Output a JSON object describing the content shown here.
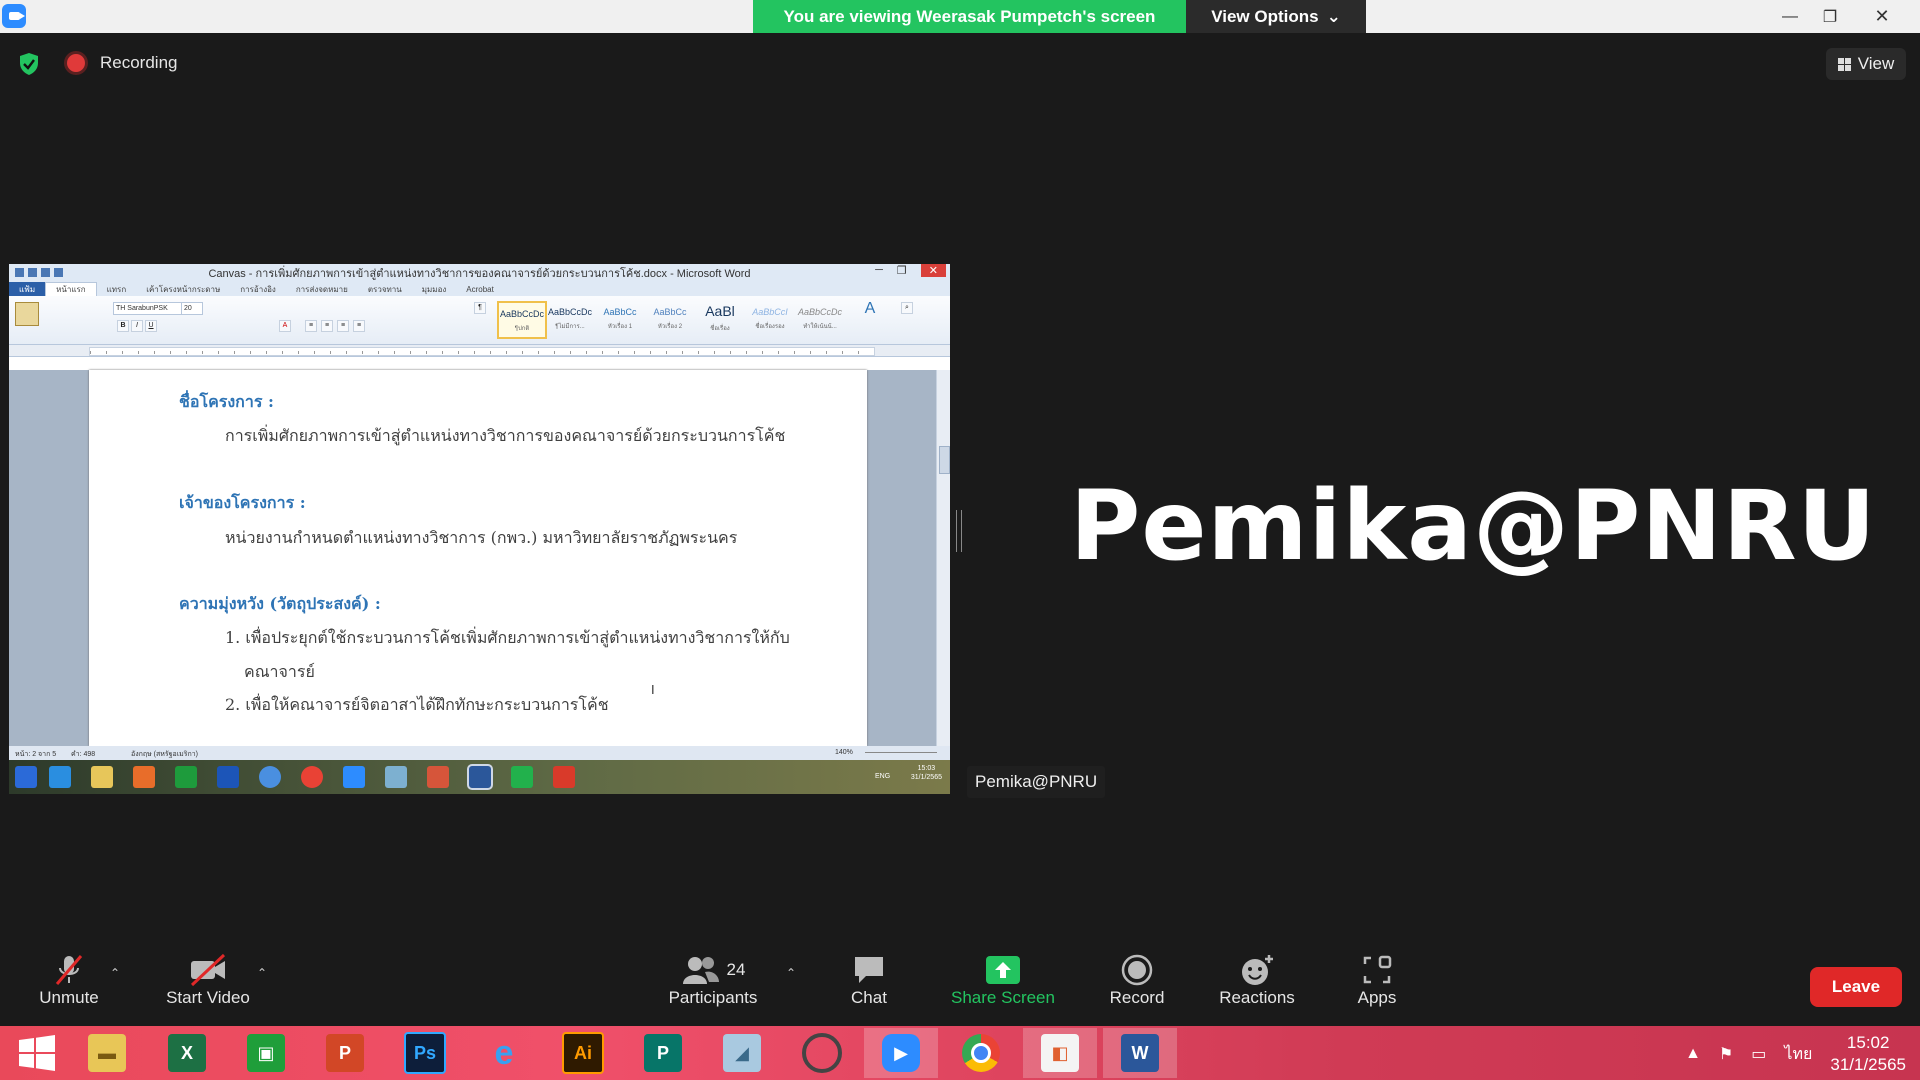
{
  "top_bar": {
    "viewing_banner": "You are viewing Weerasak Pumpetch's screen",
    "view_options_label": "View Options"
  },
  "status": {
    "recording_label": "Recording",
    "view_label": "View"
  },
  "shared_screen": {
    "word_title": "Canvas - การเพิ่มศักยภาพการเข้าสู่ตำแหน่งทางวิชาการของคณาจารย์ด้วยกระบวนการโค้ช.docx - Microsoft Word",
    "ribbon_tabs": [
      "แฟ้ม",
      "หน้าแรก",
      "แทรก",
      "เค้าโครงหน้ากระดาษ",
      "การอ้างอิง",
      "การส่งจดหมาย",
      "ตรวจทาน",
      "มุมมอง",
      "Acrobat"
    ],
    "active_tab_index": 1,
    "font_name": "TH SarabunPSK",
    "font_size": "20",
    "styles": [
      {
        "sample": "AaBbCcDc",
        "name": "¶ปกติ"
      },
      {
        "sample": "AaBbCcDc",
        "name": "¶ไม่มีการ..."
      },
      {
        "sample": "AaBbCc",
        "name": "หัวเรื่อง 1"
      },
      {
        "sample": "AaBbCc",
        "name": "หัวเรื่อง 2"
      },
      {
        "sample": "AaBl",
        "name": "ชื่อเรื่อง"
      },
      {
        "sample": "AaBbCcI",
        "name": "ชื่อเรื่องรอง"
      },
      {
        "sample": "AaBbCcDc",
        "name": "ทำให้เน้นน้..."
      }
    ],
    "document": {
      "heading_project_name": "ชื่อโครงการ :",
      "project_name": "การเพิ่มศักยภาพการเข้าสู่ตำแหน่งทางวิชาการของคณาจารย์ด้วยกระบวนการโค้ช",
      "heading_owner": "เจ้าของโครงการ :",
      "owner": "หน่วยงานกำหนดตำแหน่งทางวิชาการ (กพว.) มหาวิทยาลัยราชภัฏพระนคร",
      "heading_objectives": "ความมุ่งหวัง (วัตถุประสงค์) :",
      "objective_1_line1": "1. เพื่อประยุกต์ใช้กระบวนการโค้ชเพิ่มศักยภาพการเข้าสู่ตำแหน่งทางวิชาการให้กับ",
      "objective_1_line2": "คณาจารย์",
      "objective_2": "2. เพื่อให้คณาจารย์จิตอาสาได้ฝึกทักษะกระบวนการโค้ช"
    },
    "status_bar": {
      "page": "หน้า: 2 จาก 5",
      "words": "คำ: 498",
      "language": "อังกฤษ (สหรัฐอเมริกา)",
      "zoom": "140%"
    },
    "inner_clock_time": "15:03",
    "inner_clock_date": "31/1/2565",
    "inner_lang": "ENG"
  },
  "participant": {
    "display_name": "Pemika@PNRU",
    "name_tag": "Pemika@PNRU"
  },
  "toolbar": {
    "unmute": "Unmute",
    "start_video": "Start Video",
    "participants": "Participants",
    "participants_count": "24",
    "chat": "Chat",
    "share_screen": "Share Screen",
    "record": "Record",
    "reactions": "Reactions",
    "apps": "Apps",
    "leave": "Leave"
  },
  "taskbar": {
    "apps": [
      "file-explorer",
      "excel",
      "store",
      "powerpoint",
      "photoshop",
      "internet-explorer",
      "illustrator",
      "publisher",
      "notepad",
      "hotcape",
      "zoom",
      "chrome",
      "picture-viewer",
      "word"
    ],
    "active_app": "zoom",
    "lang": "ไทย",
    "time": "15:02",
    "date": "31/1/2565"
  },
  "colors": {
    "banner_green": "#23c460",
    "leave_red": "#e02828",
    "share_green": "#23c460",
    "heading_blue": "#2e74b5"
  }
}
